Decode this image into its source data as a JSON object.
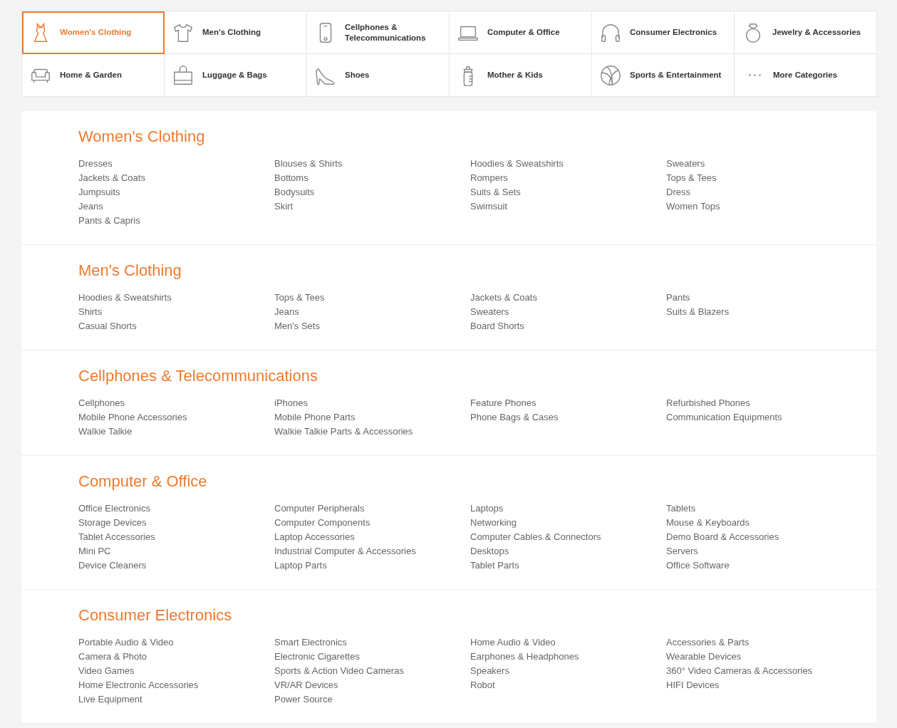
{
  "categories": [
    {
      "label": "Women's Clothing",
      "selected": true
    },
    {
      "label": "Men's Clothing",
      "selected": false
    },
    {
      "label": "Cellphones & Telecommunications",
      "selected": false
    },
    {
      "label": "Computer & Office",
      "selected": false
    },
    {
      "label": "Consumer Electronics",
      "selected": false
    },
    {
      "label": "Jewelry & Accessories",
      "selected": false
    },
    {
      "label": "Home & Garden",
      "selected": false
    },
    {
      "label": "Luggage & Bags",
      "selected": false
    },
    {
      "label": "Shoes",
      "selected": false
    },
    {
      "label": "Mother & Kids",
      "selected": false
    },
    {
      "label": "Sports & Entertainment",
      "selected": false
    },
    {
      "label": "More Categories",
      "selected": false
    }
  ],
  "sections": [
    {
      "title": "Women's Clothing",
      "columns": [
        [
          "Dresses",
          "Jackets & Coats",
          "Jumpsuits",
          "Jeans",
          "Pants & Capris"
        ],
        [
          "Blouses & Shirts",
          "Bottoms",
          "Bodysuits",
          "Skirt"
        ],
        [
          "Hoodies & Sweatshirts",
          "Rompers",
          "Suits & Sets",
          "Swimsuit"
        ],
        [
          "Sweaters",
          "Tops & Tees",
          "Dress",
          "Women Tops"
        ]
      ]
    },
    {
      "title": "Men's Clothing",
      "columns": [
        [
          "Hoodies & Sweatshirts",
          "Shirts",
          "Casual Shorts"
        ],
        [
          "Tops & Tees",
          "Jeans",
          "Men's Sets"
        ],
        [
          "Jackets & Coats",
          "Sweaters",
          "Board Shorts"
        ],
        [
          "Pants",
          "Suits & Blazers"
        ]
      ]
    },
    {
      "title": "Cellphones & Telecommunications",
      "columns": [
        [
          "Cellphones",
          "Mobile Phone Accessories",
          "Walkie Talkie"
        ],
        [
          "iPhones",
          "Mobile Phone Parts",
          "Walkie Talkie Parts & Accessories"
        ],
        [
          "Feature Phones",
          "Phone Bags & Cases"
        ],
        [
          "Refurbished Phones",
          "Communication Equipments"
        ]
      ]
    },
    {
      "title": "Computer & Office",
      "columns": [
        [
          "Office Electronics",
          "Storage Devices",
          "Tablet Accessories",
          "Mini PC",
          "Device Cleaners"
        ],
        [
          "Computer Peripherals",
          "Computer Components",
          "Laptop Accessories",
          "Industrial Computer & Accessories",
          "Laptop Parts"
        ],
        [
          "Laptops",
          "Networking",
          "Computer Cables & Connectors",
          "Desktops",
          "Tablet Parts"
        ],
        [
          "Tablets",
          "Mouse & Keyboards",
          "Demo Board & Accessories",
          "Servers",
          "Office Software"
        ]
      ]
    },
    {
      "title": "Consumer Electronics",
      "columns": [
        [
          "Portable Audio & Video",
          "Camera & Photo",
          "Video Games",
          "Home Electronic Accessories",
          "Live Equipment"
        ],
        [
          "Smart Electronics",
          "Electronic Cigarettes",
          "Sports & Action Video Cameras",
          "VR/AR Devices",
          "Power Source"
        ],
        [
          "Home Audio & Video",
          "Earphones & Headphones",
          "Speakers",
          "Robot"
        ],
        [
          "Accessories & Parts",
          "Wearable Devices",
          "360° Video Cameras & Accessories",
          "HIFI Devices"
        ]
      ]
    }
  ]
}
